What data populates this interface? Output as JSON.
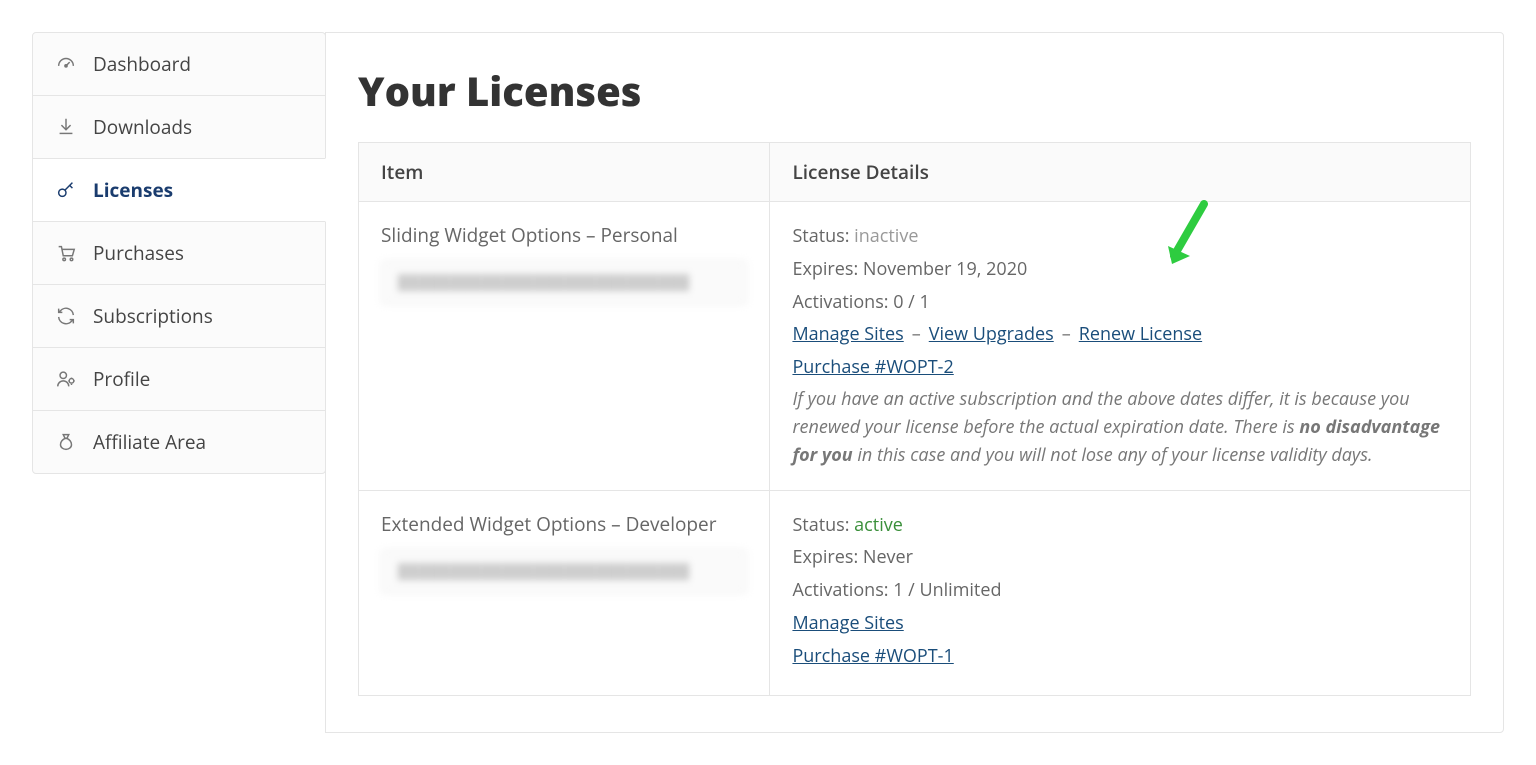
{
  "sidebar": {
    "items": [
      {
        "label": "Dashboard",
        "icon": "dashboard"
      },
      {
        "label": "Downloads",
        "icon": "download"
      },
      {
        "label": "Licenses",
        "icon": "key",
        "active": true
      },
      {
        "label": "Purchases",
        "icon": "cart"
      },
      {
        "label": "Subscriptions",
        "icon": "refresh"
      },
      {
        "label": "Profile",
        "icon": "profile"
      },
      {
        "label": "Affiliate Area",
        "icon": "moneybag"
      }
    ]
  },
  "page": {
    "title": "Your Licenses"
  },
  "table": {
    "headers": {
      "item": "Item",
      "details": "License Details"
    },
    "rows": [
      {
        "item_name": "Sliding Widget Options  –  Personal",
        "license_key_masked": "████████████████████████████",
        "status_label": "Status:",
        "status_value": "inactive",
        "status_class": "inactive",
        "expires_label": "Expires:",
        "expires_value": "November 19, 2020",
        "activations_label": "Activations:",
        "activations_value": "0  /  1",
        "links": {
          "manage_sites": "Manage Sites",
          "view_upgrades": "View Upgrades",
          "renew_license": "Renew License",
          "purchase": "Purchase #WOPT-2"
        },
        "note_prefix": "If you have an active subscription and the above dates differ, it is because you renewed your license before the actual expiration date. There is ",
        "note_strong": "no disadvantage for you",
        "note_suffix": " in this case and you will not lose any of your license validity days.",
        "show_upgrades": true,
        "show_renew": true,
        "show_note": true
      },
      {
        "item_name": "Extended Widget Options  –  Developer",
        "license_key_masked": "████████████████████████████",
        "status_label": "Status:",
        "status_value": "active",
        "status_class": "active",
        "expires_label": "Expires:",
        "expires_value": "Never",
        "activations_label": "Activations:",
        "activations_value": "1  /  Unlimited",
        "links": {
          "manage_sites": "Manage Sites",
          "purchase": "Purchase #WOPT-1"
        },
        "show_upgrades": false,
        "show_renew": false,
        "show_note": false
      }
    ]
  },
  "separator": "–"
}
